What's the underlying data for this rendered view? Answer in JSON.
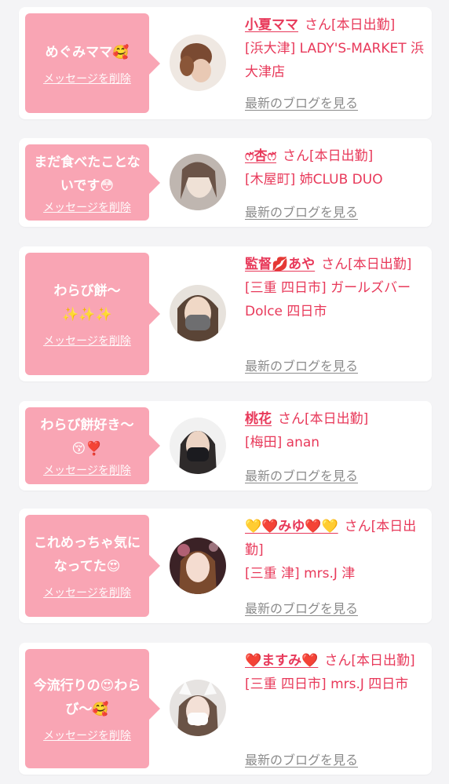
{
  "delete_label": "メッセージを削除",
  "blog_label": "最新のブログを見る",
  "cards": [
    {
      "message": "めぐみママ🥰",
      "name": "小夏ママ",
      "honorific": "さん[本日出勤]",
      "shop": "[浜大津] LADY'S-MARKET 浜大津店"
    },
    {
      "message": "まだ食べたことないです😳",
      "name": "ෆ̈杏ෆ̈",
      "honorific": "さん[本日出勤]",
      "shop": "[木屋町] 姉CLUB DUO"
    },
    {
      "message": "わらび餅〜\n✨✨✨",
      "name": "監督💋あや",
      "honorific": "さん[本日出勤]",
      "shop": "[三重 四日市] ガールズバー Dolce 四日市"
    },
    {
      "message": "わらび餅好き〜😚❣️",
      "name": "桃花",
      "honorific": "さん[本日出勤]",
      "shop": "[梅田] anan"
    },
    {
      "message": "これめっちゃ気になってた😍",
      "name": "💛❤️みゆ❤️💛",
      "honorific": "さん[本日出勤]",
      "shop": "[三重 津] mrs.J 津"
    },
    {
      "message": "今流行りの😍わらび〜🥰",
      "name": "❤️ますみ❤️",
      "honorific": "さん[本日出勤]",
      "shop": "[三重 四日市] mrs.J 四日市"
    }
  ],
  "colors": {
    "bubble": "#f9a5b4",
    "accent": "#e8395a",
    "link_gray": "#8b8b8b",
    "background": "#f4f4f6"
  }
}
